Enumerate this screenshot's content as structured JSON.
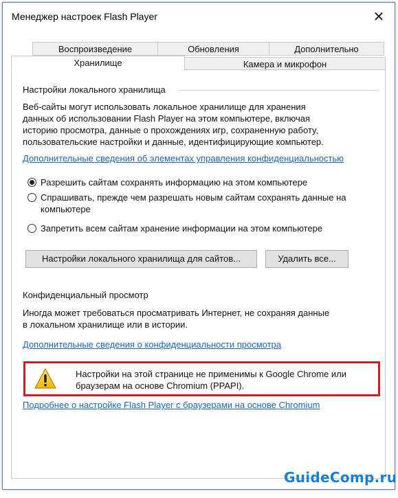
{
  "window": {
    "title": "Менеджер настроек Flash Player",
    "close_glyph": "✕"
  },
  "tabs": {
    "row1": [
      "Воспроизведение",
      "Обновления",
      "Дополнительно"
    ],
    "row2": [
      "Хранилище",
      "Камера и микрофон"
    ],
    "active": "Хранилище"
  },
  "storage": {
    "group_title": "Настройки локального хранилища",
    "description": [
      "Веб-сайты могут использовать локальное хранилище для хранения",
      "данных об использовании Flash Player на этом компьютере, включая",
      "историю просмотра, данные о прохождениях игр, сохраненную работу,",
      "пользовательские настройки и данные, идентифицирующие компьютер."
    ],
    "privacy_controls_link": "Дополнительные сведения об элементах управления конфиденциальностью",
    "options": [
      {
        "label": [
          "Разрешить сайтам сохранять информацию на этом компьютере"
        ],
        "checked": true
      },
      {
        "label": [
          "Спрашивать, прежде чем разрешать новым сайтам сохранять данные на",
          "компьютере"
        ],
        "checked": false
      },
      {
        "label": [
          "Запретить всем сайтам хранение информации на этом компьютере"
        ],
        "checked": false
      }
    ],
    "site_settings_button": "Настройки локального хранилища для сайтов...",
    "delete_all_button": "Удалить все..."
  },
  "private_browsing": {
    "group_title": "Конфиденциальный просмотр",
    "description": [
      "Иногда может требоваться просматривать Интернет, не сохраняя данные",
      "в локальном хранилище или в истории."
    ],
    "link": "Дополнительные сведения о конфиденциальности просмотра"
  },
  "warning": {
    "icon": "warning-triangle-icon",
    "text": [
      "Настройки на этой странице не применимы к Google Chrome или",
      "браузерам на основе Chromium (PPAPI)."
    ],
    "border_color": "#cc1f25"
  },
  "chromium_link": "Подробнее о настройке Flash Player с браузерами на основе Chromium",
  "watermark": "GuideComp.ru",
  "colors": {
    "link": "#1a64c4",
    "accent_border": "#5b7fb0"
  }
}
